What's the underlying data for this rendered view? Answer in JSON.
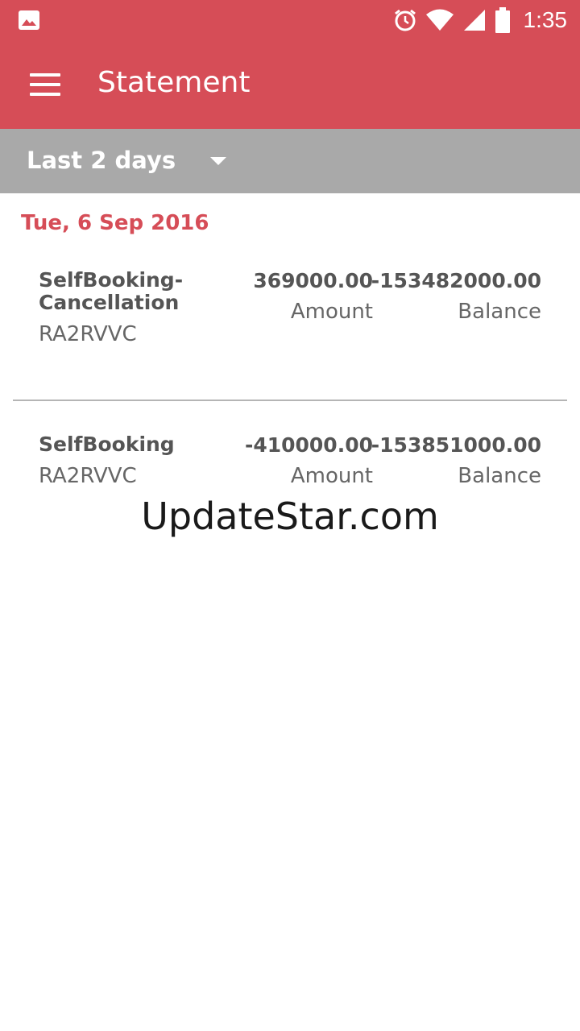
{
  "status_bar": {
    "time": "1:35",
    "icons": [
      "image-icon",
      "alarm-icon",
      "wifi-icon",
      "signal-icon",
      "battery-icon"
    ]
  },
  "app_bar": {
    "title": "Statement",
    "menu_icon": "hamburger-menu-icon"
  },
  "filter": {
    "selected": "Last 2 days",
    "caret_icon": "dropdown-caret-icon"
  },
  "statement": {
    "date": "Tue, 6 Sep 2016",
    "entries": [
      {
        "name": "SelfBooking-\nCancellation",
        "ref": "RA2RVVC",
        "amount": "369000.00",
        "amount_label": "Amount",
        "balance": "-153482000.00",
        "balance_label": "Balance"
      },
      {
        "name": "SelfBooking",
        "ref": "RA2RVVC",
        "amount": "-410000.00",
        "amount_label": "Amount",
        "balance": "-153851000.00",
        "balance_label": "Balance"
      }
    ]
  },
  "watermark": "UpdateStar.com",
  "colors": {
    "primary": "#d64d57",
    "filter_bar": "#a9a9a9",
    "text": "#555555"
  }
}
